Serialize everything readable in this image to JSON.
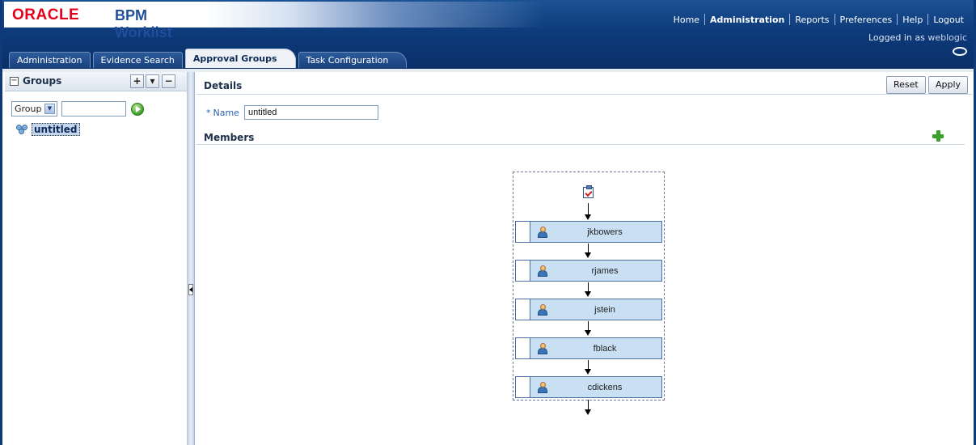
{
  "app": {
    "brand_oracle": "ORACLE",
    "brand_product": "BPM Worklist"
  },
  "global_nav": {
    "home": "Home",
    "administration": "Administration",
    "reports": "Reports",
    "preferences": "Preferences",
    "help": "Help",
    "logout": "Logout"
  },
  "session": {
    "logged_in_prefix": "Logged in as",
    "user": "weblogic"
  },
  "tabs": [
    {
      "label": "Administration",
      "selected": false
    },
    {
      "label": "Evidence Search",
      "selected": false
    },
    {
      "label": "Approval Groups",
      "selected": true
    },
    {
      "label": "Task Configuration",
      "selected": false
    }
  ],
  "left_panel": {
    "title": "Groups",
    "add_symbol": "+",
    "menu_symbol": "▾",
    "remove_symbol": "−",
    "filter_select": "Group",
    "search_value": "",
    "tree_items": [
      {
        "label": "untitled",
        "selected": true
      }
    ]
  },
  "details": {
    "title": "Details",
    "reset_label": "Reset",
    "apply_label": "Apply",
    "required_marker": "*",
    "name_label": "Name",
    "name_value": "untitled"
  },
  "members": {
    "title": "Members",
    "list": [
      "jkbowers",
      "rjames",
      "jstein",
      "fblack",
      "cdickens"
    ]
  },
  "colors": {
    "header_blue": "#0d3a7a",
    "oracle_red": "#e3001b",
    "node_fill": "#c9dff4",
    "add_green": "#3aa12a"
  }
}
